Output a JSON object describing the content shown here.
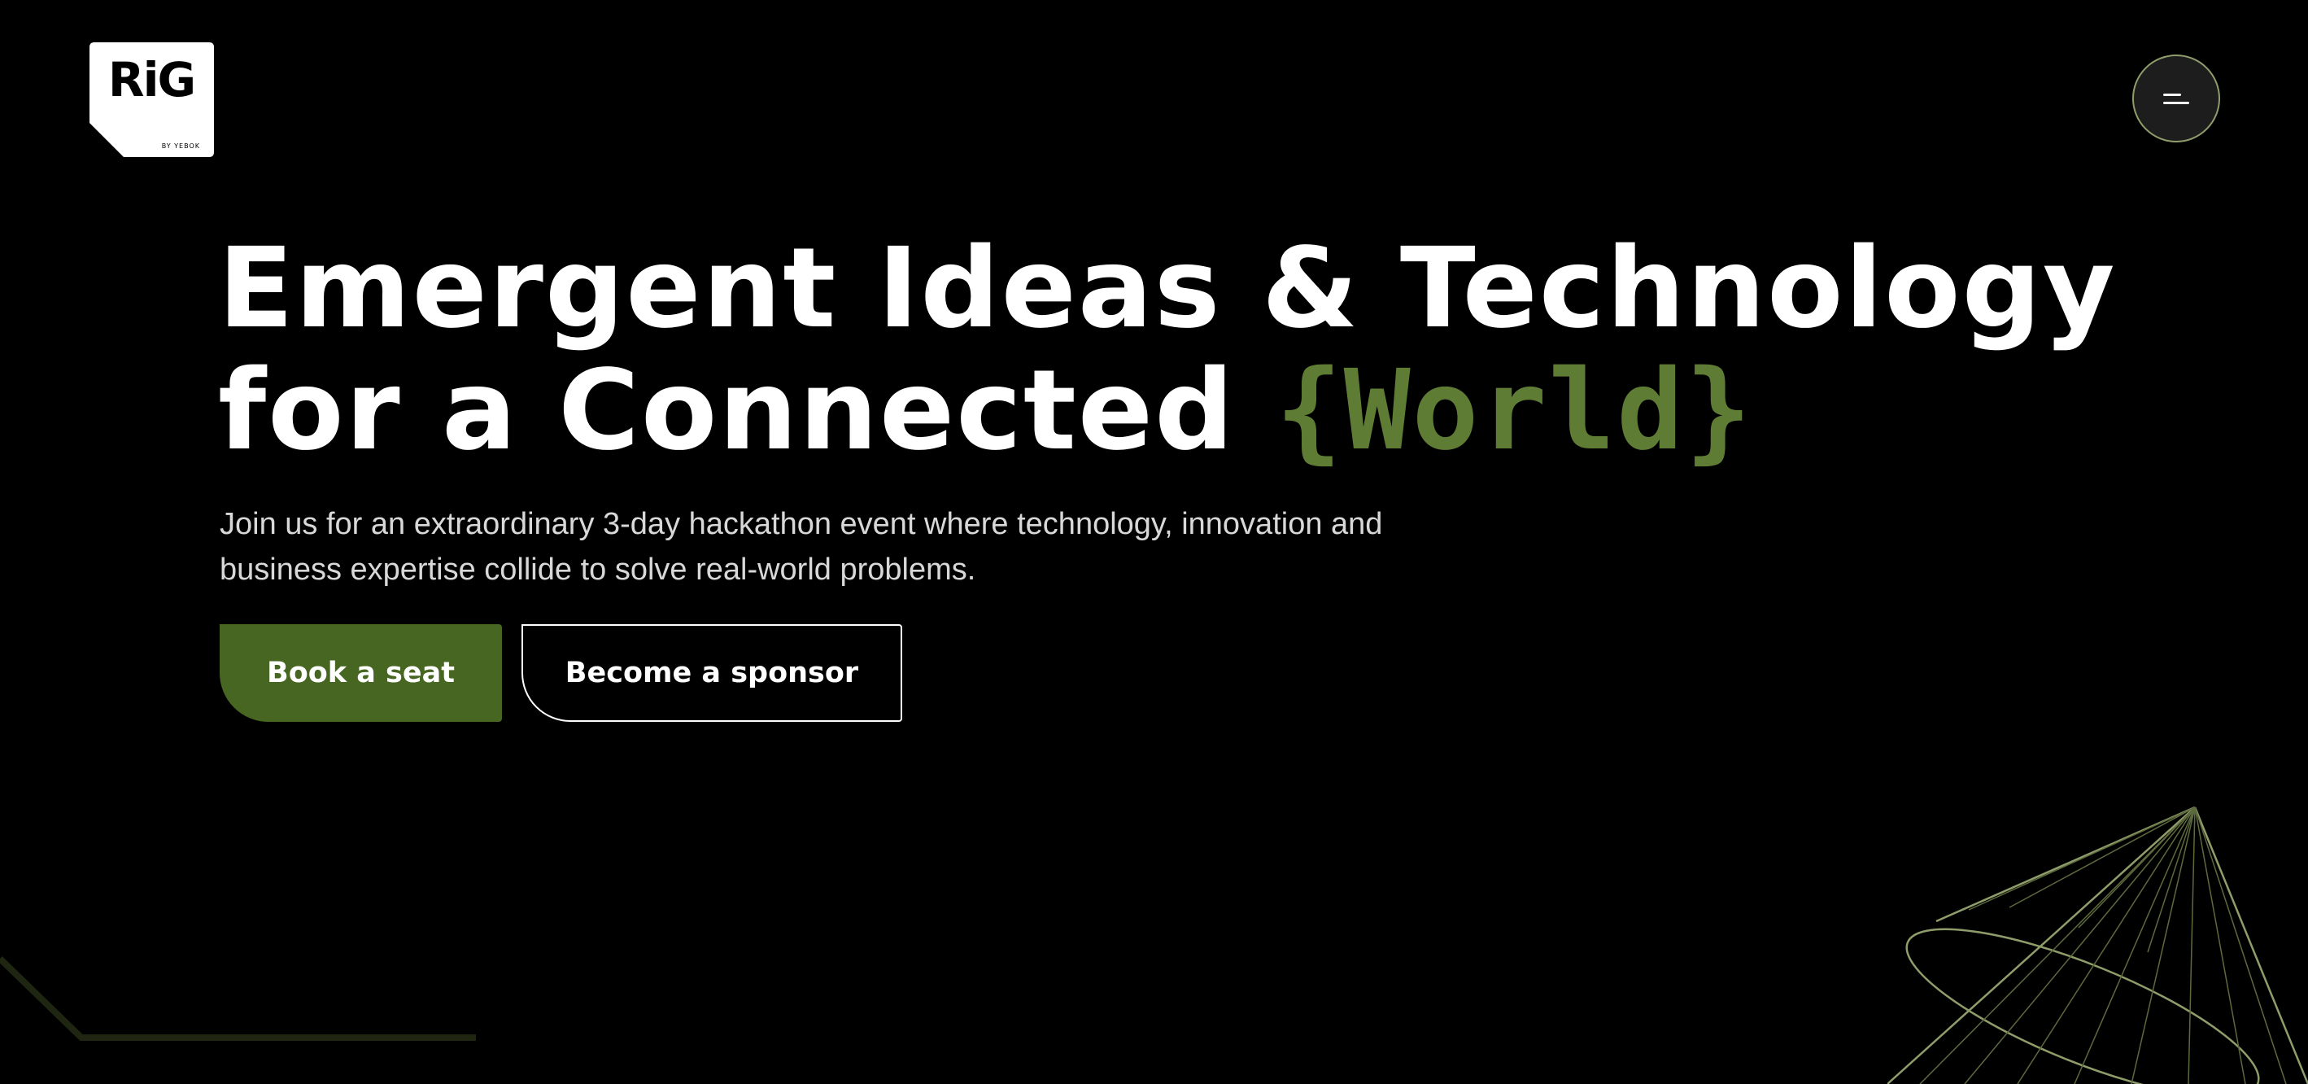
{
  "logo": {
    "wordmark": "RiG",
    "byline": "BY YEBOK"
  },
  "menu": {
    "icon": "menu-icon"
  },
  "hero": {
    "title_line1": "Emergent Ideas & Technology",
    "title_line2_prefix": "for a Connected ",
    "title_line2_accent": "{World}",
    "description": "Join us for an extraordinary 3-day hackathon event where technology, innovation and business expertise collide to solve real-world problems."
  },
  "actions": {
    "primary_label": "Book a seat",
    "secondary_label": "Become a sponsor"
  },
  "colors": {
    "background": "#000000",
    "accent": "#5f7c35",
    "primary_button": "#476622",
    "decoration": "#8f9d6a"
  }
}
